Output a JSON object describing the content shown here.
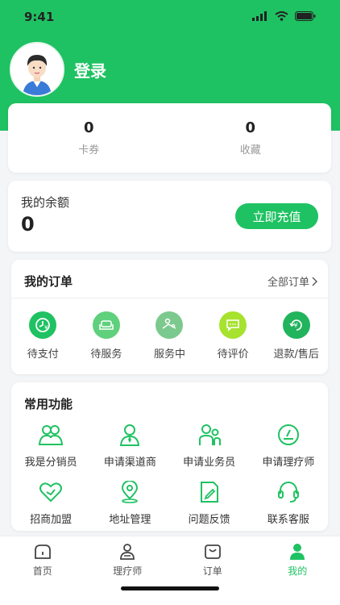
{
  "status_bar": {
    "time": "9:41"
  },
  "profile": {
    "login_label": "登录"
  },
  "stats": [
    {
      "value": "0",
      "label": "卡券"
    },
    {
      "value": "0",
      "label": "收藏"
    }
  ],
  "balance": {
    "label": "我的余额",
    "value": "0",
    "recharge_label": "立即充值"
  },
  "orders": {
    "title": "我的订单",
    "all_label": "全部订单",
    "items": [
      {
        "label": "待支付",
        "icon": "pending-payment-icon",
        "color": "#1fc262"
      },
      {
        "label": "待服务",
        "icon": "sofa-icon",
        "color": "#5fd07c"
      },
      {
        "label": "服务中",
        "icon": "massage-icon",
        "color": "#7cc98e"
      },
      {
        "label": "待评价",
        "icon": "comment-icon",
        "color": "#a6e22e"
      },
      {
        "label": "退款/售后",
        "icon": "refund-icon",
        "color": "#21b45d"
      }
    ]
  },
  "functions": {
    "title": "常用功能",
    "items": [
      {
        "label": "我是分销员",
        "icon": "users-icon"
      },
      {
        "label": "申请渠道商",
        "icon": "agent-icon"
      },
      {
        "label": "申请业务员",
        "icon": "salesman-icon"
      },
      {
        "label": "申请理疗师",
        "icon": "therapist-icon"
      },
      {
        "label": "招商加盟",
        "icon": "heart-icon"
      },
      {
        "label": "地址管理",
        "icon": "location-icon"
      },
      {
        "label": "问题反馈",
        "icon": "feedback-icon"
      },
      {
        "label": "联系客服",
        "icon": "headset-icon"
      }
    ]
  },
  "tabbar": [
    {
      "label": "首页",
      "icon": "home-icon",
      "active": false
    },
    {
      "label": "理疗师",
      "icon": "therapist-tab-icon",
      "active": false
    },
    {
      "label": "订单",
      "icon": "order-tab-icon",
      "active": false
    },
    {
      "label": "我的",
      "icon": "profile-icon",
      "active": true
    }
  ],
  "colors": {
    "accent": "#1fc262",
    "background": "#f4f5f7"
  }
}
